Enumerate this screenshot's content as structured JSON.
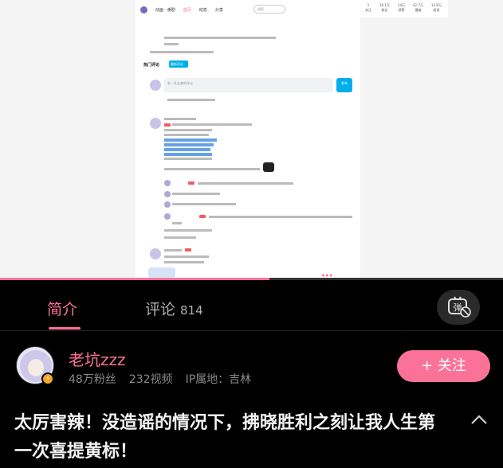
{
  "video": {
    "nav": [
      "动画 · 番剧",
      "首页",
      "动态",
      "分享"
    ],
    "search_placeholder": "搜索",
    "stats": [
      {
        "value": "1",
        "label": "关注"
      },
      {
        "value": "10.1万",
        "label": "粉丝"
      },
      {
        "value": "14万",
        "label": "获赞"
      },
      {
        "value": "42.7万",
        "label": "播放"
      },
      {
        "value": "12.8万",
        "label": "阅读"
      }
    ],
    "tab_hot": "热门评论",
    "tab_new": "最新评论",
    "input_placeholder": "发一条友善的评论",
    "send_label": "发布",
    "progress_fraction": 0.535
  },
  "tabs": {
    "intro": "简介",
    "comments": "评论",
    "comments_count": "814"
  },
  "uploader": {
    "name": "老坑zzz",
    "fans": "48万粉丝",
    "videos": "232视频",
    "ip": "IP属地：吉林",
    "follow_label": "+ 关注",
    "badge_icon": "lightning-icon"
  },
  "title": "太厉害辣！没造谣的情况下，拂晓胜利之刻让我人生第一次喜提黄标！",
  "icons": [
    "danmaku-off-icon",
    "chevron-up-icon",
    "lightning-icon"
  ],
  "colors": {
    "accent": "#fb7299",
    "background": "#000000",
    "badge": "#f5a623"
  }
}
